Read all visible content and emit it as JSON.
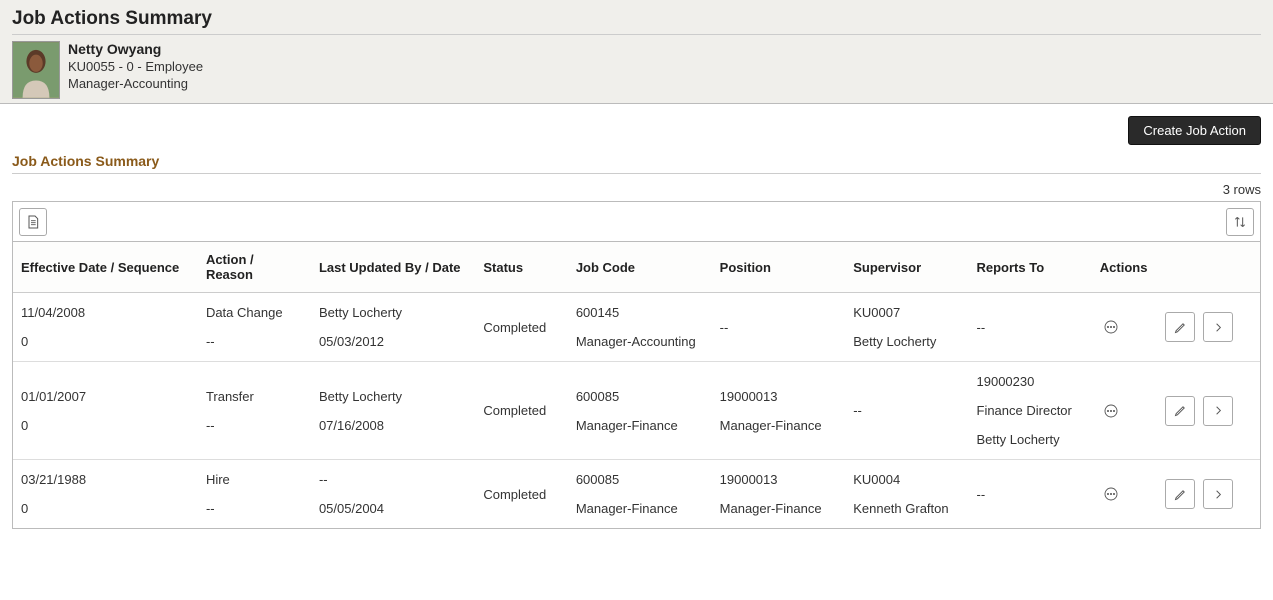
{
  "pageTitle": "Job Actions Summary",
  "employee": {
    "name": "Netty Owyang",
    "idLine": "KU0055 - 0 - Employee",
    "role": "Manager-Accounting"
  },
  "buttons": {
    "createJobAction": "Create Job Action"
  },
  "sectionTitle": "Job Actions Summary",
  "rowCountLabel": "3 rows",
  "columns": {
    "effDateSeq": "Effective Date / Sequence",
    "actionReason": "Action / Reason",
    "lastUpdated": "Last Updated By / Date",
    "status": "Status",
    "jobCode": "Job Code",
    "position": "Position",
    "supervisor": "Supervisor",
    "reportsTo": "Reports To",
    "actions": "Actions"
  },
  "rows": [
    {
      "effDate": "11/04/2008",
      "sequence": "0",
      "action": "Data Change",
      "reason": "--",
      "updatedBy": "Betty Locherty",
      "updatedDate": "05/03/2012",
      "status": "Completed",
      "jobCode": "600145",
      "jobCodeDesc": "Manager-Accounting",
      "position": "--",
      "positionDesc": "",
      "supervisorId": "KU0007",
      "supervisorName": "Betty Locherty",
      "reportsToId": "--",
      "reportsToTitle": "",
      "reportsToName": ""
    },
    {
      "effDate": "01/01/2007",
      "sequence": "0",
      "action": "Transfer",
      "reason": "--",
      "updatedBy": "Betty Locherty",
      "updatedDate": "07/16/2008",
      "status": "Completed",
      "jobCode": "600085",
      "jobCodeDesc": "Manager-Finance",
      "position": "19000013",
      "positionDesc": "Manager-Finance",
      "supervisorId": "--",
      "supervisorName": "",
      "reportsToId": "19000230",
      "reportsToTitle": "Finance Director",
      "reportsToName": "Betty Locherty"
    },
    {
      "effDate": "03/21/1988",
      "sequence": "0",
      "action": "Hire",
      "reason": "--",
      "updatedBy": "--",
      "updatedDate": "05/05/2004",
      "status": "Completed",
      "jobCode": "600085",
      "jobCodeDesc": "Manager-Finance",
      "position": "19000013",
      "positionDesc": "Manager-Finance",
      "supervisorId": "KU0004",
      "supervisorName": "Kenneth Grafton",
      "reportsToId": "--",
      "reportsToTitle": "",
      "reportsToName": ""
    }
  ]
}
